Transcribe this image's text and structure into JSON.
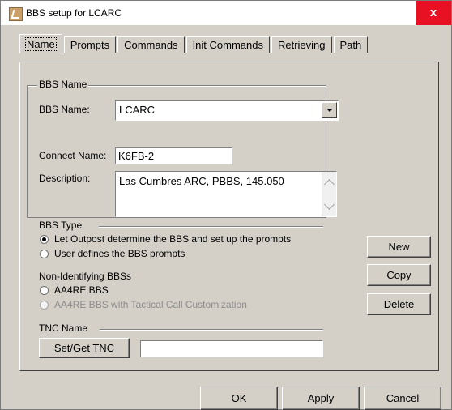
{
  "window": {
    "title": "BBS setup for LCARC",
    "close_label": "x"
  },
  "tabs": [
    {
      "label": "Name"
    },
    {
      "label": "Prompts"
    },
    {
      "label": "Commands"
    },
    {
      "label": "Init Commands"
    },
    {
      "label": "Retrieving"
    },
    {
      "label": "Path"
    }
  ],
  "bbs_name_group": {
    "title": "BBS Name",
    "bbs_name_label": "BBS Name:",
    "bbs_name_value": "LCARC",
    "connect_name_label": "Connect Name:",
    "connect_name_value": "K6FB-2",
    "description_label": "Description:",
    "description_value": "Las Cumbres ARC, PBBS, 145.050"
  },
  "bbs_type": {
    "title": "BBS Type",
    "option1": "Let Outpost determine the BBS and set up the prompts",
    "option2": "User defines the BBS prompts"
  },
  "non_identifying": {
    "title": "Non-Identifying BBSs",
    "option1": "AA4RE BBS",
    "option2": "AA4RE BBS with Tactical Call Customization"
  },
  "tnc": {
    "title": "TNC Name",
    "button": "Set/Get TNC",
    "value": ""
  },
  "side_buttons": {
    "new": "New",
    "copy": "Copy",
    "delete": "Delete"
  },
  "footer": {
    "ok": "OK",
    "apply": "Apply",
    "cancel": "Cancel"
  }
}
